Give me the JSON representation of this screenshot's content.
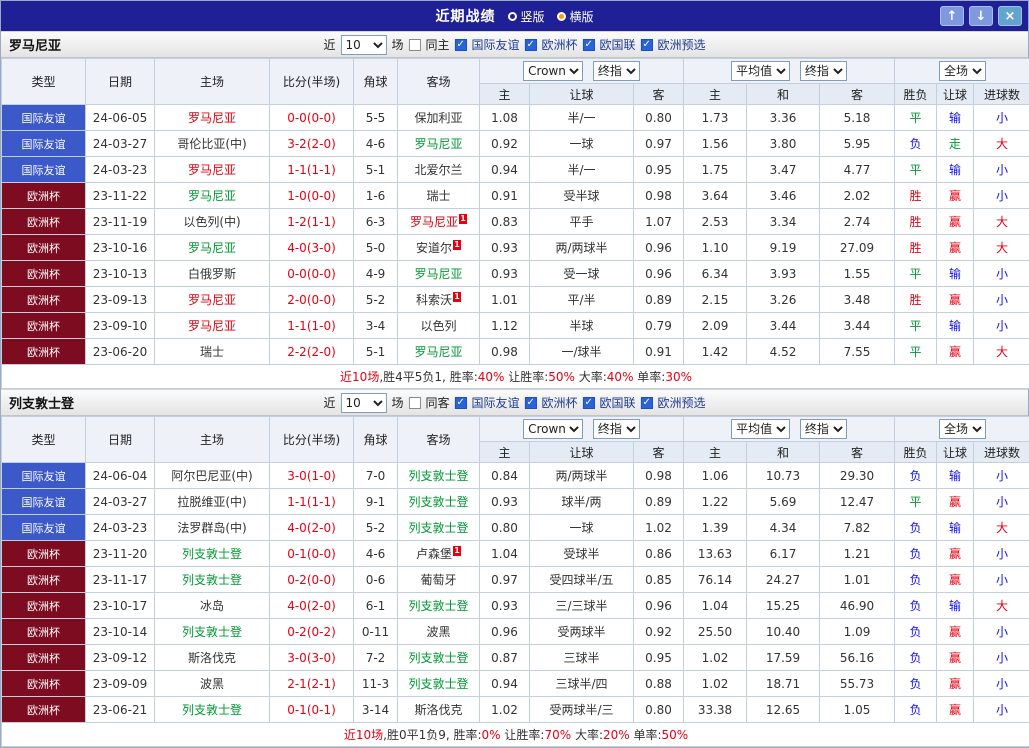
{
  "titlebar": {
    "title": "近期战绩",
    "radios": [
      {
        "label": "竖版",
        "selected": false
      },
      {
        "label": "横版",
        "selected": true
      }
    ],
    "buttons": {
      "up": "↑",
      "down": "↓",
      "close": "×"
    }
  },
  "controls": {
    "near": "近",
    "count": "10",
    "matches": "场",
    "bookmaker": "Crown",
    "final_odds": "终指",
    "average": "平均值",
    "final_odds2": "终指",
    "scope": "全场"
  },
  "headers": {
    "type": "类型",
    "date": "日期",
    "home": "主场",
    "score": "比分(半场)",
    "corner": "角球",
    "away": "客场",
    "ah_home": "主",
    "ah_line": "让球",
    "ah_away": "客",
    "eu_home": "主",
    "eu_draw": "和",
    "eu_away": "客",
    "result": "胜负",
    "handicap": "让球",
    "goals": "进球数"
  },
  "colors": {
    "name": {
      "red": "#e60012",
      "green": "#009933",
      "black": "#333333"
    },
    "type": {
      "国际友谊": "#3c59c9",
      "欧洲杯": "#7d0c21"
    },
    "outcome": {
      "胜": "#e60012",
      "平": "#009933",
      "负": "#1010ee",
      "赢": "#e60012",
      "走": "#009933",
      "输": "#1010ee",
      "大": "#e60012",
      "小": "#1010ee"
    },
    "score": "#e60012"
  },
  "sections": [
    {
      "team": "罗马尼亚",
      "venue_label": "同主",
      "filters": [
        "国际友谊",
        "欧洲杯",
        "欧国联",
        "欧洲预选"
      ],
      "rows": [
        {
          "type": "国际友谊",
          "date": "24-06-05",
          "home": "罗马尼亚",
          "homeC": "red",
          "homeSup": "",
          "score": "0-0(0-0)",
          "corner": "5-5",
          "away": "保加利亚",
          "awayC": "black",
          "awaySup": "",
          "ah": [
            "1.08",
            "半/一",
            "0.80"
          ],
          "eu": [
            "1.73",
            "3.36",
            "5.18"
          ],
          "res": "平",
          "han": "输",
          "goal": "小"
        },
        {
          "type": "国际友谊",
          "date": "24-03-27",
          "home": "哥伦比亚(中)",
          "homeC": "black",
          "homeSup": "",
          "score": "3-2(2-0)",
          "corner": "4-6",
          "away": "罗马尼亚",
          "awayC": "green",
          "awaySup": "",
          "ah": [
            "0.92",
            "一球",
            "0.97"
          ],
          "eu": [
            "1.56",
            "3.80",
            "5.95"
          ],
          "res": "负",
          "han": "走",
          "goal": "大"
        },
        {
          "type": "国际友谊",
          "date": "24-03-23",
          "home": "罗马尼亚",
          "homeC": "red",
          "homeSup": "",
          "score": "1-1(1-1)",
          "corner": "5-1",
          "away": "北爱尔兰",
          "awayC": "black",
          "awaySup": "",
          "ah": [
            "0.94",
            "半/一",
            "0.95"
          ],
          "eu": [
            "1.75",
            "3.47",
            "4.77"
          ],
          "res": "平",
          "han": "输",
          "goal": "小"
        },
        {
          "type": "欧洲杯",
          "date": "23-11-22",
          "home": "罗马尼亚",
          "homeC": "green",
          "homeSup": "",
          "score": "1-0(0-0)",
          "corner": "1-6",
          "away": "瑞士",
          "awayC": "black",
          "awaySup": "",
          "ah": [
            "0.91",
            "受半球",
            "0.98"
          ],
          "eu": [
            "3.64",
            "3.46",
            "2.02"
          ],
          "res": "胜",
          "han": "赢",
          "goal": "小"
        },
        {
          "type": "欧洲杯",
          "date": "23-11-19",
          "home": "以色列(中)",
          "homeC": "black",
          "homeSup": "",
          "score": "1-2(1-1)",
          "corner": "6-3",
          "away": "罗马尼亚",
          "awayC": "red",
          "awaySup": "1",
          "ah": [
            "0.83",
            "平手",
            "1.07"
          ],
          "eu": [
            "2.53",
            "3.34",
            "2.74"
          ],
          "res": "胜",
          "han": "赢",
          "goal": "大"
        },
        {
          "type": "欧洲杯",
          "date": "23-10-16",
          "home": "罗马尼亚",
          "homeC": "green",
          "homeSup": "",
          "score": "4-0(3-0)",
          "corner": "5-0",
          "away": "安道尔",
          "awayC": "black",
          "awaySup": "1",
          "ah": [
            "0.93",
            "两/两球半",
            "0.96"
          ],
          "eu": [
            "1.10",
            "9.19",
            "27.09"
          ],
          "res": "胜",
          "han": "赢",
          "goal": "大"
        },
        {
          "type": "欧洲杯",
          "date": "23-10-13",
          "home": "白俄罗斯",
          "homeC": "black",
          "homeSup": "",
          "score": "0-0(0-0)",
          "corner": "4-9",
          "away": "罗马尼亚",
          "awayC": "green",
          "awaySup": "",
          "ah": [
            "0.93",
            "受一球",
            "0.96"
          ],
          "eu": [
            "6.34",
            "3.93",
            "1.55"
          ],
          "res": "平",
          "han": "输",
          "goal": "小"
        },
        {
          "type": "欧洲杯",
          "date": "23-09-13",
          "home": "罗马尼亚",
          "homeC": "red",
          "homeSup": "",
          "score": "2-0(0-0)",
          "corner": "5-2",
          "away": "科索沃",
          "awayC": "black",
          "awaySup": "1",
          "ah": [
            "1.01",
            "平/半",
            "0.89"
          ],
          "eu": [
            "2.15",
            "3.26",
            "3.48"
          ],
          "res": "胜",
          "han": "赢",
          "goal": "小"
        },
        {
          "type": "欧洲杯",
          "date": "23-09-10",
          "home": "罗马尼亚",
          "homeC": "red",
          "homeSup": "",
          "score": "1-1(1-0)",
          "corner": "3-4",
          "away": "以色列",
          "awayC": "black",
          "awaySup": "",
          "ah": [
            "1.12",
            "半球",
            "0.79"
          ],
          "eu": [
            "2.09",
            "3.44",
            "3.44"
          ],
          "res": "平",
          "han": "输",
          "goal": "小"
        },
        {
          "type": "欧洲杯",
          "date": "23-06-20",
          "home": "瑞士",
          "homeC": "black",
          "homeSup": "",
          "score": "2-2(2-0)",
          "corner": "5-1",
          "away": "罗马尼亚",
          "awayC": "green",
          "awaySup": "",
          "ah": [
            "0.98",
            "一/球半",
            "0.91"
          ],
          "eu": [
            "1.42",
            "4.52",
            "7.55"
          ],
          "res": "平",
          "han": "赢",
          "goal": "大"
        }
      ],
      "summary": {
        "prefix": "近10场",
        "record": ",胜4平5负1, ",
        "stats": [
          [
            "胜率:",
            "40%"
          ],
          [
            "让胜率:",
            "50%"
          ],
          [
            "大率:",
            "40%"
          ],
          [
            "单率:",
            "30%"
          ]
        ]
      }
    },
    {
      "team": "列支敦士登",
      "venue_label": "同客",
      "filters": [
        "国际友谊",
        "欧洲杯",
        "欧国联",
        "欧洲预选"
      ],
      "rows": [
        {
          "type": "国际友谊",
          "date": "24-06-04",
          "home": "阿尔巴尼亚(中)",
          "homeC": "black",
          "homeSup": "",
          "score": "3-0(1-0)",
          "corner": "7-0",
          "away": "列支敦士登",
          "awayC": "green",
          "awaySup": "",
          "ah": [
            "0.84",
            "两/两球半",
            "0.98"
          ],
          "eu": [
            "1.06",
            "10.73",
            "29.30"
          ],
          "res": "负",
          "han": "输",
          "goal": "小"
        },
        {
          "type": "国际友谊",
          "date": "24-03-27",
          "home": "拉脱维亚(中)",
          "homeC": "black",
          "homeSup": "",
          "score": "1-1(1-1)",
          "corner": "9-1",
          "away": "列支敦士登",
          "awayC": "green",
          "awaySup": "",
          "ah": [
            "0.93",
            "球半/两",
            "0.89"
          ],
          "eu": [
            "1.22",
            "5.69",
            "12.47"
          ],
          "res": "平",
          "han": "赢",
          "goal": "小"
        },
        {
          "type": "国际友谊",
          "date": "24-03-23",
          "home": "法罗群岛(中)",
          "homeC": "black",
          "homeSup": "",
          "score": "4-0(2-0)",
          "corner": "5-2",
          "away": "列支敦士登",
          "awayC": "green",
          "awaySup": "",
          "ah": [
            "0.80",
            "一球",
            "1.02"
          ],
          "eu": [
            "1.39",
            "4.34",
            "7.82"
          ],
          "res": "负",
          "han": "输",
          "goal": "大"
        },
        {
          "type": "欧洲杯",
          "date": "23-11-20",
          "home": "列支敦士登",
          "homeC": "green",
          "homeSup": "",
          "score": "0-1(0-0)",
          "corner": "4-6",
          "away": "卢森堡",
          "awayC": "black",
          "awaySup": "1",
          "ah": [
            "1.04",
            "受球半",
            "0.86"
          ],
          "eu": [
            "13.63",
            "6.17",
            "1.21"
          ],
          "res": "负",
          "han": "赢",
          "goal": "小"
        },
        {
          "type": "欧洲杯",
          "date": "23-11-17",
          "home": "列支敦士登",
          "homeC": "green",
          "homeSup": "",
          "score": "0-2(0-0)",
          "corner": "0-6",
          "away": "葡萄牙",
          "awayC": "black",
          "awaySup": "",
          "ah": [
            "0.97",
            "受四球半/五",
            "0.85"
          ],
          "eu": [
            "76.14",
            "24.27",
            "1.01"
          ],
          "res": "负",
          "han": "赢",
          "goal": "小"
        },
        {
          "type": "欧洲杯",
          "date": "23-10-17",
          "home": "冰岛",
          "homeC": "black",
          "homeSup": "",
          "score": "4-0(2-0)",
          "corner": "6-1",
          "away": "列支敦士登",
          "awayC": "green",
          "awaySup": "",
          "ah": [
            "0.93",
            "三/三球半",
            "0.96"
          ],
          "eu": [
            "1.04",
            "15.25",
            "46.90"
          ],
          "res": "负",
          "han": "输",
          "goal": "大"
        },
        {
          "type": "欧洲杯",
          "date": "23-10-14",
          "home": "列支敦士登",
          "homeC": "green",
          "homeSup": "",
          "score": "0-2(0-2)",
          "corner": "0-11",
          "away": "波黑",
          "awayC": "black",
          "awaySup": "",
          "ah": [
            "0.96",
            "受两球半",
            "0.92"
          ],
          "eu": [
            "25.50",
            "10.40",
            "1.09"
          ],
          "res": "负",
          "han": "赢",
          "goal": "小"
        },
        {
          "type": "欧洲杯",
          "date": "23-09-12",
          "home": "斯洛伐克",
          "homeC": "black",
          "homeSup": "",
          "score": "3-0(3-0)",
          "corner": "7-2",
          "away": "列支敦士登",
          "awayC": "green",
          "awaySup": "",
          "ah": [
            "0.87",
            "三球半",
            "0.95"
          ],
          "eu": [
            "1.02",
            "17.59",
            "56.16"
          ],
          "res": "负",
          "han": "赢",
          "goal": "小"
        },
        {
          "type": "欧洲杯",
          "date": "23-09-09",
          "home": "波黑",
          "homeC": "black",
          "homeSup": "",
          "score": "2-1(2-1)",
          "corner": "11-3",
          "away": "列支敦士登",
          "awayC": "green",
          "awaySup": "",
          "ah": [
            "0.94",
            "三球半/四",
            "0.88"
          ],
          "eu": [
            "1.02",
            "18.71",
            "55.73"
          ],
          "res": "负",
          "han": "赢",
          "goal": "小"
        },
        {
          "type": "欧洲杯",
          "date": "23-06-21",
          "home": "列支敦士登",
          "homeC": "green",
          "homeSup": "",
          "score": "0-1(0-1)",
          "corner": "3-14",
          "away": "斯洛伐克",
          "awayC": "black",
          "awaySup": "",
          "ah": [
            "1.02",
            "受两球半/三",
            "0.80"
          ],
          "eu": [
            "33.38",
            "12.65",
            "1.05"
          ],
          "res": "负",
          "han": "赢",
          "goal": "小"
        }
      ],
      "summary": {
        "prefix": "近10场",
        "record": ",胜0平1负9, ",
        "stats": [
          [
            "胜率:",
            "0%"
          ],
          [
            "让胜率:",
            "70%"
          ],
          [
            "大率:",
            "20%"
          ],
          [
            "单率:",
            "50%"
          ]
        ]
      }
    }
  ]
}
